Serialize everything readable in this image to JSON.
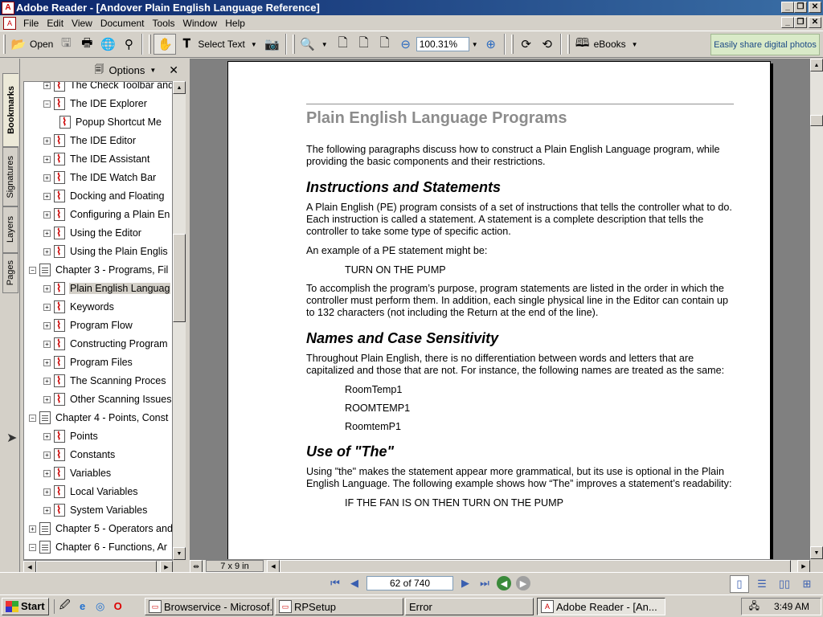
{
  "window": {
    "title": "Adobe Reader - [Andover Plain English Language Reference]",
    "app_icon": "adobe-reader-icon"
  },
  "menu": [
    "File",
    "Edit",
    "View",
    "Document",
    "Tools",
    "Window",
    "Help"
  ],
  "toolbar": {
    "open_label": "Open",
    "select_text_label": "Select Text",
    "zoom_value": "100.31%",
    "ebooks_label": "eBooks",
    "promo_text": "Easily share digital photos"
  },
  "side_tabs": [
    "Bookmarks",
    "Signatures",
    "Layers",
    "Pages"
  ],
  "bookmarks": {
    "options_label": "Options",
    "items": [
      {
        "label": "The Check Toolbar and",
        "level": 1,
        "icon": "pdf",
        "expander": "+"
      },
      {
        "label": "The IDE Explorer",
        "level": 1,
        "icon": "pdf",
        "expander": "-"
      },
      {
        "label": "Popup Shortcut Me",
        "level": 2,
        "icon": "pdf",
        "expander": ""
      },
      {
        "label": "The IDE Editor",
        "level": 1,
        "icon": "pdf",
        "expander": "+"
      },
      {
        "label": "The IDE Assistant",
        "level": 1,
        "icon": "pdf",
        "expander": "+"
      },
      {
        "label": "The IDE Watch Bar",
        "level": 1,
        "icon": "pdf",
        "expander": "+"
      },
      {
        "label": "Docking and Floating",
        "level": 1,
        "icon": "pdf",
        "expander": "+"
      },
      {
        "label": "Configuring a Plain En",
        "level": 1,
        "icon": "pdf",
        "expander": "+"
      },
      {
        "label": "Using the Editor",
        "level": 1,
        "icon": "pdf",
        "expander": "+"
      },
      {
        "label": "Using the Plain Englis",
        "level": 1,
        "icon": "pdf",
        "expander": "+"
      },
      {
        "label": "Chapter 3 - Programs, Fil",
        "level": 0,
        "icon": "page",
        "expander": "-"
      },
      {
        "label": "Plain English Languag",
        "level": 1,
        "icon": "pdf",
        "expander": "+",
        "selected": true
      },
      {
        "label": "Keywords",
        "level": 1,
        "icon": "pdf",
        "expander": "+"
      },
      {
        "label": "Program Flow",
        "level": 1,
        "icon": "pdf",
        "expander": "+"
      },
      {
        "label": "Constructing Program",
        "level": 1,
        "icon": "pdf",
        "expander": "+"
      },
      {
        "label": "Program Files",
        "level": 1,
        "icon": "pdf",
        "expander": "+"
      },
      {
        "label": " The Scanning Proces",
        "level": 1,
        "icon": "pdf",
        "expander": "+"
      },
      {
        "label": "Other Scanning Issues",
        "level": 1,
        "icon": "pdf",
        "expander": "+"
      },
      {
        "label": "Chapter 4 - Points, Const",
        "level": 0,
        "icon": "page",
        "expander": "-"
      },
      {
        "label": "Points",
        "level": 1,
        "icon": "pdf",
        "expander": "+"
      },
      {
        "label": "Constants",
        "level": 1,
        "icon": "pdf",
        "expander": "+"
      },
      {
        "label": "Variables",
        "level": 1,
        "icon": "pdf",
        "expander": "+"
      },
      {
        "label": "Local Variables",
        "level": 1,
        "icon": "pdf",
        "expander": "+"
      },
      {
        "label": "System Variables",
        "level": 1,
        "icon": "pdf",
        "expander": "+"
      },
      {
        "label": "Chapter 5 - Operators and",
        "level": 0,
        "icon": "page",
        "expander": "+"
      },
      {
        "label": "Chapter 6 - Functions, Ar",
        "level": 0,
        "icon": "page",
        "expander": "-"
      }
    ]
  },
  "document": {
    "heading": "Plain English Language Programs",
    "intro": "The following paragraphs discuss how to construct a Plain English Language program, while providing the basic components and their restrictions.",
    "sec1_title": "Instructions and Statements",
    "sec1_p1": "A Plain English (PE) program consists of a set of instructions that tells the controller what to do. Each instruction is called a statement. A statement is a complete description that tells the controller to take some type of specific action.",
    "sec1_p2": "An example of a PE statement might be:",
    "sec1_code": "TURN ON THE PUMP",
    "sec1_p3": "To accomplish the program’s purpose, program statements are listed in the order in which the controller must perform them. In addition, each single physical line in the Editor can contain up to 132 characters (not including the Return at the end of the line).",
    "sec2_title": "Names and Case Sensitivity",
    "sec2_p1": "Throughout Plain English, there is no differentiation between words and letters that are capitalized and those that are not. For instance, the following names are treated as the same:",
    "sec2_names": [
      "RoomTemp1",
      "ROOMTEMP1",
      "RoomtemP1"
    ],
    "sec3_title": "Use of \"The\"",
    "sec3_p1": "Using \"the\" makes the statement appear more grammatical, but its use is optional in the Plain English Language. The following example shows how “The” improves a statement’s readability:",
    "sec3_code": "IF THE FAN IS ON THEN TURN ON THE PUMP",
    "page_size": "7 x 9 in"
  },
  "navigation": {
    "page_indicator": "62 of 740"
  },
  "taskbar": {
    "start_label": "Start",
    "tasks": [
      {
        "label": "Browservice - Microsof...",
        "active": false
      },
      {
        "label": "RPSetup",
        "active": false
      },
      {
        "label": "Error",
        "active": false
      },
      {
        "label": "Adobe Reader - [An...",
        "active": true
      }
    ],
    "clock": "3:49 AM"
  }
}
